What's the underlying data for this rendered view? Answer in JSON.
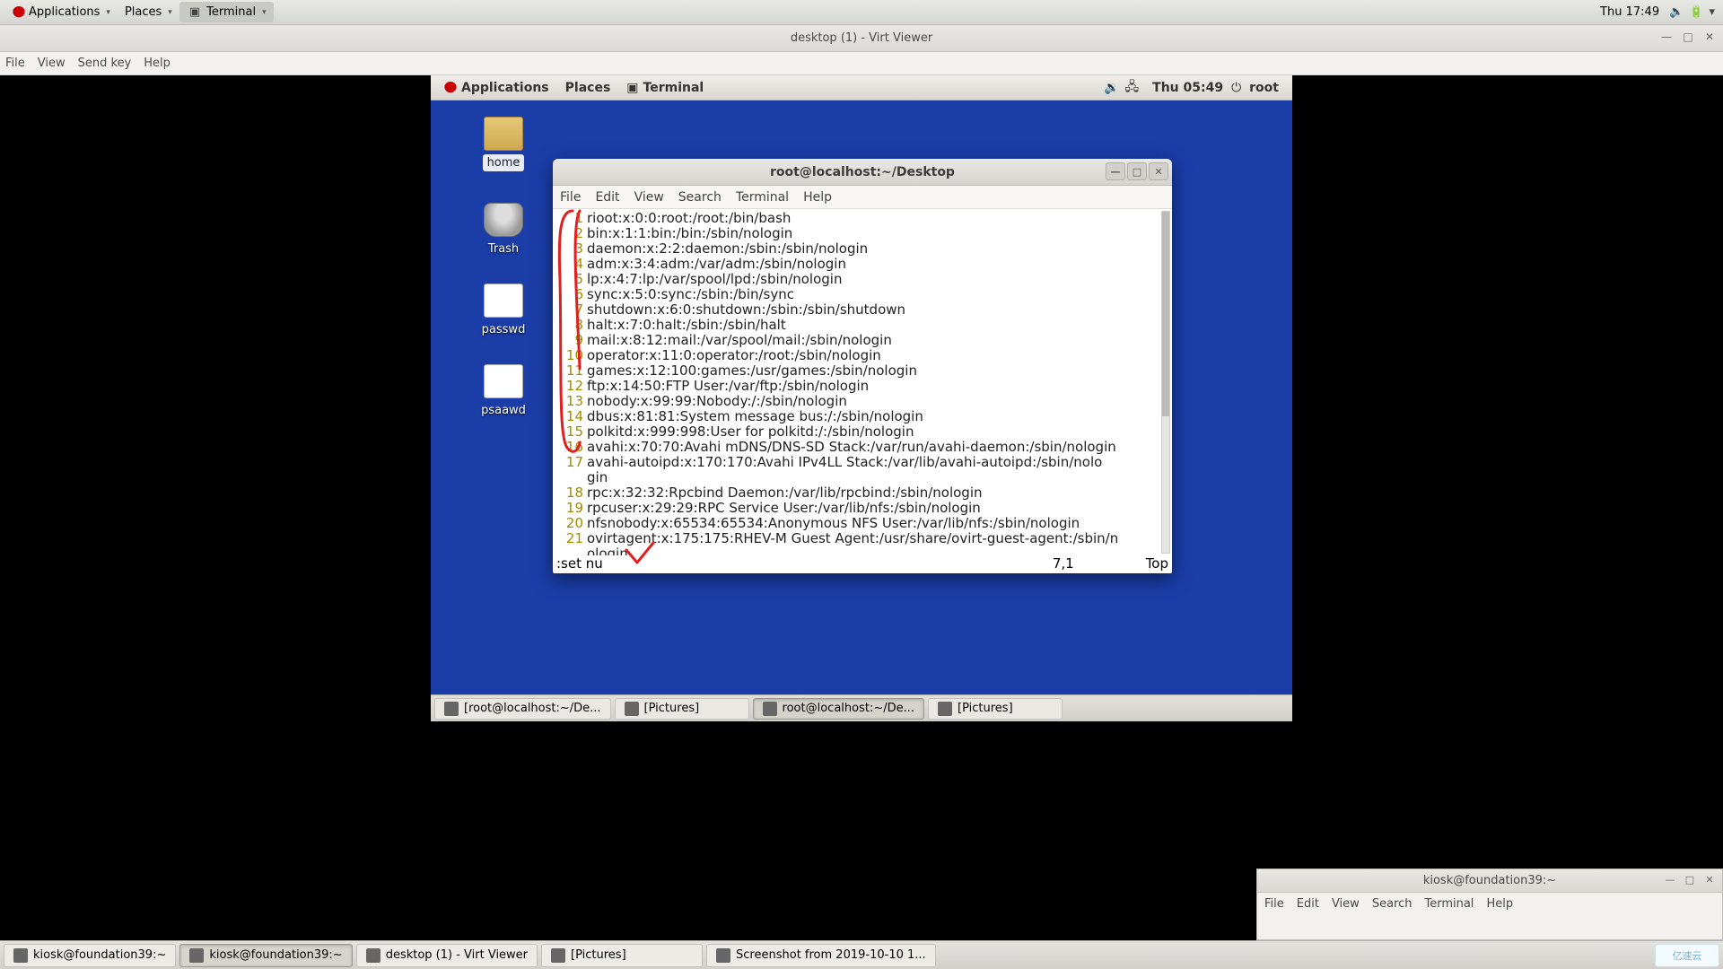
{
  "host": {
    "topbar": {
      "applications": "Applications",
      "places": "Places",
      "terminal": "Terminal",
      "clock": "Thu 17:49"
    },
    "taskbar": {
      "items": [
        {
          "label": "kiosk@foundation39:~",
          "active": false
        },
        {
          "label": "kiosk@foundation39:~",
          "active": true
        },
        {
          "label": "desktop (1) - Virt Viewer",
          "active": false
        },
        {
          "label": "[Pictures]",
          "active": false
        },
        {
          "label": "Screenshot from 2019-10-10 1...",
          "active": false
        }
      ],
      "corner": "亿速云"
    },
    "extra_term": {
      "title": "kiosk@foundation39:~",
      "menu": [
        "File",
        "Edit",
        "View",
        "Search",
        "Terminal",
        "Help"
      ]
    }
  },
  "vv": {
    "title": "desktop (1) - Virt Viewer",
    "menu": {
      "file": "File",
      "view": "View",
      "sendkey": "Send key",
      "help": "Help"
    }
  },
  "guest": {
    "topbar": {
      "applications": "Applications",
      "places": "Places",
      "terminal": "Terminal",
      "clock": "Thu 05:49",
      "user": "root"
    },
    "desktop_icons": {
      "home": "home",
      "trash": "Trash",
      "passwd": "passwd",
      "psaawd": "psaawd"
    },
    "taskbar": {
      "items": [
        {
          "label": "[root@localhost:~/De...",
          "active": false
        },
        {
          "label": "[Pictures]",
          "active": false
        },
        {
          "label": "root@localhost:~/De...",
          "active": true
        },
        {
          "label": "[Pictures]",
          "active": false
        }
      ]
    },
    "term": {
      "title": "root@localhost:~/Desktop",
      "menu": [
        "File",
        "Edit",
        "View",
        "Search",
        "Terminal",
        "Help"
      ],
      "lines": [
        {
          "n": "1",
          "t": "rioot:x:0:0:root:/root:/bin/bash"
        },
        {
          "n": "2",
          "t": "bin:x:1:1:bin:/bin:/sbin/nologin"
        },
        {
          "n": "3",
          "t": "daemon:x:2:2:daemon:/sbin:/sbin/nologin"
        },
        {
          "n": "4",
          "t": "adm:x:3:4:adm:/var/adm:/sbin/nologin"
        },
        {
          "n": "5",
          "t": "lp:x:4:7:lp:/var/spool/lpd:/sbin/nologin"
        },
        {
          "n": "6",
          "t": "sync:x:5:0:sync:/sbin:/bin/sync"
        },
        {
          "n": "7",
          "t": "shutdown:x:6:0:shutdown:/sbin:/sbin/shutdown"
        },
        {
          "n": "8",
          "t": "halt:x:7:0:halt:/sbin:/sbin/halt"
        },
        {
          "n": "9",
          "t": "mail:x:8:12:mail:/var/spool/mail:/sbin/nologin"
        },
        {
          "n": "10",
          "t": "operator:x:11:0:operator:/root:/sbin/nologin"
        },
        {
          "n": "11",
          "t": "games:x:12:100:games:/usr/games:/sbin/nologin"
        },
        {
          "n": "12",
          "t": "ftp:x:14:50:FTP User:/var/ftp:/sbin/nologin"
        },
        {
          "n": "13",
          "t": "nobody:x:99:99:Nobody:/:/sbin/nologin"
        },
        {
          "n": "14",
          "t": "dbus:x:81:81:System message bus:/:/sbin/nologin"
        },
        {
          "n": "15",
          "t": "polkitd:x:999:998:User for polkitd:/:/sbin/nologin"
        },
        {
          "n": "16",
          "t": "avahi:x:70:70:Avahi mDNS/DNS-SD Stack:/var/run/avahi-daemon:/sbin/nologin"
        },
        {
          "n": "17",
          "t": "avahi-autoipd:x:170:170:Avahi IPv4LL Stack:/var/lib/avahi-autoipd:/sbin/nolo"
        },
        {
          "n": "",
          "t": "gin"
        },
        {
          "n": "18",
          "t": "rpc:x:32:32:Rpcbind Daemon:/var/lib/rpcbind:/sbin/nologin"
        },
        {
          "n": "19",
          "t": "rpcuser:x:29:29:RPC Service User:/var/lib/nfs:/sbin/nologin"
        },
        {
          "n": "20",
          "t": "nfsnobody:x:65534:65534:Anonymous NFS User:/var/lib/nfs:/sbin/nologin"
        },
        {
          "n": "21",
          "t": "ovirtagent:x:175:175:RHEV-M Guest Agent:/usr/share/ovirt-guest-agent:/sbin/n"
        },
        {
          "n": "",
          "t": "ologin"
        }
      ],
      "status": {
        "cmd": ":set  nu",
        "pos": "7,1",
        "loc": "Top"
      }
    }
  }
}
